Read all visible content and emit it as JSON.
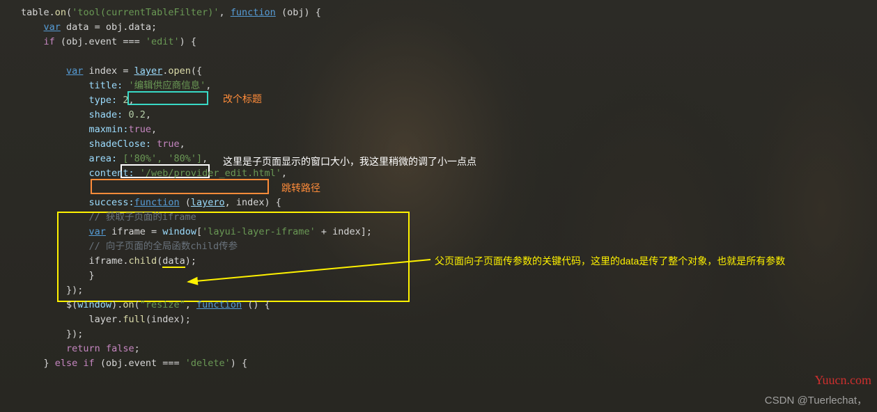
{
  "code": {
    "line1_a": "table.",
    "line1_b": "on",
    "line1_c": "(",
    "line1_d": "'tool(currentTableFilter)'",
    "line1_e": ", ",
    "line1_f": "function",
    "line1_g": " (obj) {",
    "line2_a": "var",
    "line2_b": " data = obj.data;",
    "line3_a": "if",
    "line3_b": " (obj.event === ",
    "line3_c": "'edit'",
    "line3_d": ") {",
    "line5_a": "var",
    "line5_b": " index = ",
    "line5_c": "layer",
    "line5_d": ".",
    "line5_e": "open",
    "line5_f": "({",
    "line6_a": "title:",
    "line6_b": "'编辑供应商信息'",
    "line6_c": ",",
    "line7_a": "type:",
    "line7_b": " 2",
    "line7_c": ",",
    "line8_a": "shade:",
    "line8_b": " 0.2",
    "line8_c": ",",
    "line9_a": "maxmin:",
    "line9_b": "true",
    "line9_c": ",",
    "line10_a": "shadeClose:",
    "line10_b": " true",
    "line10_c": ",",
    "line11_a": "area:",
    "line11_b": "['80%', '80%']",
    "line11_c": ",",
    "line12_a": "content:",
    "line12_b": "'/web/provider_edit.html'",
    "line12_c": ",",
    "line14_a": "success:",
    "line14_b": "function",
    "line14_c": " (",
    "line14_d": "layero",
    "line14_e": ", index) {",
    "line15": "// 获取子页面的iframe",
    "line16_a": "var",
    "line16_b": " iframe = ",
    "line16_c": "window",
    "line16_d": "[",
    "line16_e": "'layui-layer-iframe'",
    "line16_f": " + index];",
    "line17": "// 向子页面的全局函数child传参",
    "line18_a": "iframe.",
    "line18_b": "child",
    "line18_c": "(",
    "line18_d": "data",
    "line18_e": ");",
    "line19": "}",
    "line20": "});",
    "line21_a": "$(",
    "line21_b": "window",
    "line21_c": ").",
    "line21_d": "on",
    "line21_e": "(",
    "line21_f": "\"resize\"",
    "line21_g": ", ",
    "line21_h": "function",
    "line21_i": " () {",
    "line22_a": "layer.",
    "line22_b": "full",
    "line22_c": "(index);",
    "line23": "});",
    "line24_a": "return",
    "line24_b": " false",
    "line24_c": ";",
    "line25_a": "} ",
    "line25_b": "else if",
    "line25_c": " (obj.event === ",
    "line25_d": "'delete'",
    "line25_e": ") {"
  },
  "annotations": {
    "title_note": "改个标题",
    "area_note": "这里是子页面显示的窗口大小，我这里稍微的调了小一点点",
    "content_note": "跳转路径",
    "success_note": "父页面向子页面传参数的关键代码，这里的data是传了整个对象，也就是所有参数"
  },
  "watermarks": {
    "yuucn": "Yuucn.com",
    "csdn": "CSDN @Tuerlechat，"
  }
}
